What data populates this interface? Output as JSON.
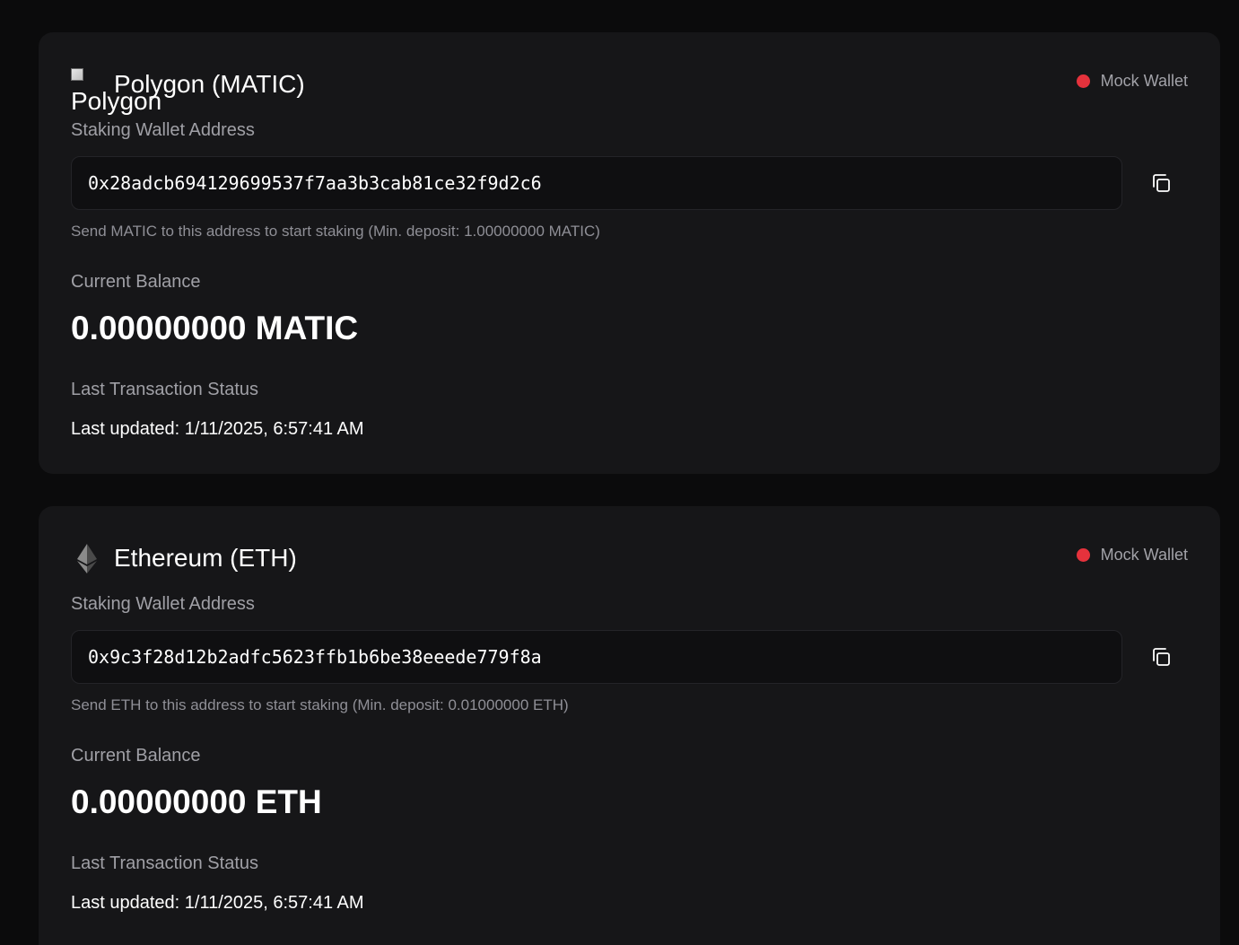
{
  "wallets": [
    {
      "title": "Polygon (MATIC)",
      "logo_alt": "Polygon",
      "logo_icon": "broken-image-icon",
      "status_label": "Mock Wallet",
      "status_color": "#e5323c",
      "address_label": "Staking Wallet Address",
      "address": "0x28adcb694129699537f7aa3b3cab81ce32f9d2c6",
      "deposit_hint": "Send MATIC to this address to start staking (Min. deposit: 1.00000000 MATIC)",
      "balance_label": "Current Balance",
      "balance": "0.00000000 MATIC",
      "tx_status_label": "Last Transaction Status",
      "last_updated": "Last updated: 1/11/2025, 6:57:41 AM"
    },
    {
      "title": "Ethereum (ETH)",
      "logo_icon": "ethereum-icon",
      "status_label": "Mock Wallet",
      "status_color": "#e5323c",
      "address_label": "Staking Wallet Address",
      "address": "0x9c3f28d12b2adfc5623ffb1b6be38eeede779f8a",
      "deposit_hint": "Send ETH to this address to start staking (Min. deposit: 0.01000000 ETH)",
      "balance_label": "Current Balance",
      "balance": "0.00000000 ETH",
      "tx_status_label": "Last Transaction Status",
      "last_updated": "Last updated: 1/11/2025, 6:57:41 AM"
    }
  ]
}
